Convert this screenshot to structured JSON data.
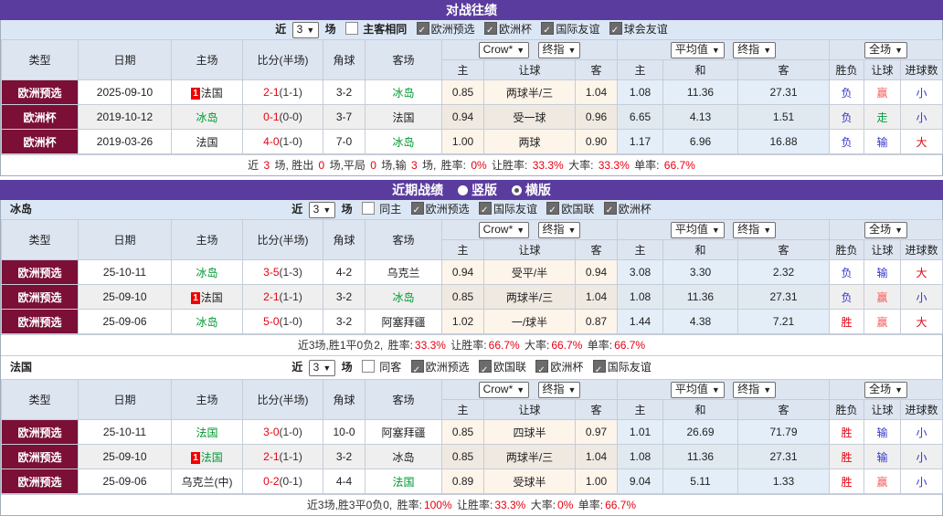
{
  "colors": {
    "title_bar_purple": "#5a3c9e",
    "type_cell_maroon": "#7b0f36",
    "header_bg": "#dde5f1",
    "odds_cream_bg": "#fdf4ea",
    "avg_blue_bg": "#e3eef8",
    "win_red": "#e60012",
    "handicap_win_pink": "#fa5a5a",
    "lose_blue": "#3434cf",
    "draw_green": "#00a03c",
    "team_green": "#009933"
  },
  "table_header": {
    "type": "类型",
    "date": "日期",
    "home": "主场",
    "score": "比分(半场)",
    "corner": "角球",
    "away": "客场",
    "dd_crow": "Crow*",
    "dd_final1": "终指",
    "dd_avg": "平均值",
    "dd_final2": "终指",
    "dd_full": "全场",
    "sub_home": "主",
    "sub_handicap": "让球",
    "sub_away": "客",
    "sub_home2": "主",
    "sub_draw": "和",
    "sub_away2": "客",
    "sub_result": "胜负",
    "sub_handicap_result": "让球",
    "sub_goals": "进球数"
  },
  "h2h": {
    "title": "对战往绩",
    "controls": {
      "near": "近",
      "select": "3",
      "games": "场",
      "same": "主客相同",
      "leagues": [
        "欧洲预选",
        "欧洲杯",
        "国际友谊",
        "球会友谊"
      ]
    },
    "rows": [
      {
        "type": "欧洲预选",
        "date": "2025-09-10",
        "badge": "1",
        "home": "法国",
        "score": "2-1",
        "half": "(1-1)",
        "corner": "3-2",
        "away": "冰岛",
        "o_home": "0.85",
        "o_hcp": "两球半/三",
        "o_away": "1.04",
        "a_home": "1.08",
        "a_draw": "11.36",
        "a_away": "27.31",
        "r1": "负",
        "r2": "赢",
        "r3": "小"
      },
      {
        "type": "欧洲杯",
        "date": "2019-10-12",
        "home": "冰岛",
        "score": "0-1",
        "half": "(0-0)",
        "corner": "3-7",
        "away": "法国",
        "o_home": "0.94",
        "o_hcp": "受一球",
        "o_away": "0.96",
        "a_home": "6.65",
        "a_draw": "4.13",
        "a_away": "1.51",
        "r1": "负",
        "r2": "走",
        "r3": "小"
      },
      {
        "type": "欧洲杯",
        "date": "2019-03-26",
        "home": "法国",
        "score": "4-0",
        "half": "(1-0)",
        "corner": "7-0",
        "away": "冰岛",
        "o_home": "1.00",
        "o_hcp": "两球",
        "o_away": "0.90",
        "a_home": "1.17",
        "a_draw": "6.96",
        "a_away": "16.88",
        "r1": "负",
        "r2": "输",
        "r3": "大"
      }
    ],
    "summary": {
      "seg": [
        "近 ",
        "3",
        " 场, 胜出 ",
        "0",
        " 场,平局 ",
        "0",
        " 场,输 ",
        "3",
        " 场, "
      ],
      "stats": [
        {
          "label": "胜率: ",
          "value": "0%"
        },
        {
          "label": "让胜率: ",
          "value": "33.3%"
        },
        {
          "label": "大率: ",
          "value": "33.3%"
        },
        {
          "label": "单率: ",
          "value": "66.7%"
        }
      ]
    }
  },
  "recent": {
    "title": "近期战绩",
    "radio_vertical": "竖版",
    "radio_horizontal": "横版",
    "iceland": {
      "team": "冰岛",
      "controls": {
        "near": "近",
        "select": "3",
        "games": "场",
        "same": "同主",
        "leagues": [
          "欧洲预选",
          "国际友谊",
          "欧国联",
          "欧洲杯"
        ]
      },
      "rows": [
        {
          "type": "欧洲预选",
          "date": "25-10-11",
          "home": "冰岛",
          "score": "3-5",
          "half": "(1-3)",
          "corner": "4-2",
          "away": "乌克兰",
          "o_home": "0.94",
          "o_hcp": "受平/半",
          "o_away": "0.94",
          "a_home": "3.08",
          "a_draw": "3.30",
          "a_away": "2.32",
          "r1": "负",
          "r2": "输",
          "r3": "大"
        },
        {
          "type": "欧洲预选",
          "date": "25-09-10",
          "badge": "1",
          "home": "法国",
          "score": "2-1",
          "half": "(1-1)",
          "corner": "3-2",
          "away": "冰岛",
          "o_home": "0.85",
          "o_hcp": "两球半/三",
          "o_away": "1.04",
          "a_home": "1.08",
          "a_draw": "11.36",
          "a_away": "27.31",
          "r1": "负",
          "r2": "赢",
          "r3": "小"
        },
        {
          "type": "欧洲预选",
          "date": "25-09-06",
          "home": "冰岛",
          "score": "5-0",
          "half": "(1-0)",
          "corner": "3-2",
          "away": "阿塞拜疆",
          "o_home": "1.02",
          "o_hcp": "一/球半",
          "o_away": "0.87",
          "a_home": "1.44",
          "a_draw": "4.38",
          "a_away": "7.21",
          "r1": "胜",
          "r2": "赢",
          "r3": "大"
        }
      ],
      "summary": {
        "lead": "近3场,胜1平0负2, ",
        "stats": [
          {
            "label": "胜率:",
            "value": "33.3%"
          },
          {
            "label": "让胜率:",
            "value": "66.7%"
          },
          {
            "label": "大率:",
            "value": "66.7%"
          },
          {
            "label": "单率:",
            "value": "66.7%"
          }
        ]
      }
    },
    "france": {
      "team": "法国",
      "controls": {
        "near": "近",
        "select": "3",
        "games": "场",
        "same": "同客",
        "leagues": [
          "欧洲预选",
          "欧国联",
          "欧洲杯",
          "国际友谊"
        ]
      },
      "rows": [
        {
          "type": "欧洲预选",
          "date": "25-10-11",
          "home": "法国",
          "score": "3-0",
          "half": "(1-0)",
          "corner": "10-0",
          "away": "阿塞拜疆",
          "o_home": "0.85",
          "o_hcp": "四球半",
          "o_away": "0.97",
          "a_home": "1.01",
          "a_draw": "26.69",
          "a_away": "71.79",
          "r1": "胜",
          "r2": "输",
          "r3": "小"
        },
        {
          "type": "欧洲预选",
          "date": "25-09-10",
          "badge": "1",
          "home": "法国",
          "score": "2-1",
          "half": "(1-1)",
          "corner": "3-2",
          "away": "冰岛",
          "o_home": "0.85",
          "o_hcp": "两球半/三",
          "o_away": "1.04",
          "a_home": "1.08",
          "a_draw": "11.36",
          "a_away": "27.31",
          "r1": "胜",
          "r2": "输",
          "r3": "小"
        },
        {
          "type": "欧洲预选",
          "date": "25-09-06",
          "home": "乌克兰(中)",
          "score": "0-2",
          "half": "(0-1)",
          "corner": "4-4",
          "away": "法国",
          "o_home": "0.89",
          "o_hcp": "受球半",
          "o_away": "1.00",
          "a_home": "9.04",
          "a_draw": "5.11",
          "a_away": "1.33",
          "r1": "胜",
          "r2": "赢",
          "r3": "小"
        }
      ],
      "summary": {
        "lead": "近3场,胜3平0负0, ",
        "stats": [
          {
            "label": "胜率:",
            "value": "100%"
          },
          {
            "label": "让胜率:",
            "value": "33.3%"
          },
          {
            "label": "大率:",
            "value": "0%"
          },
          {
            "label": "单率:",
            "value": "66.7%"
          }
        ]
      }
    }
  }
}
